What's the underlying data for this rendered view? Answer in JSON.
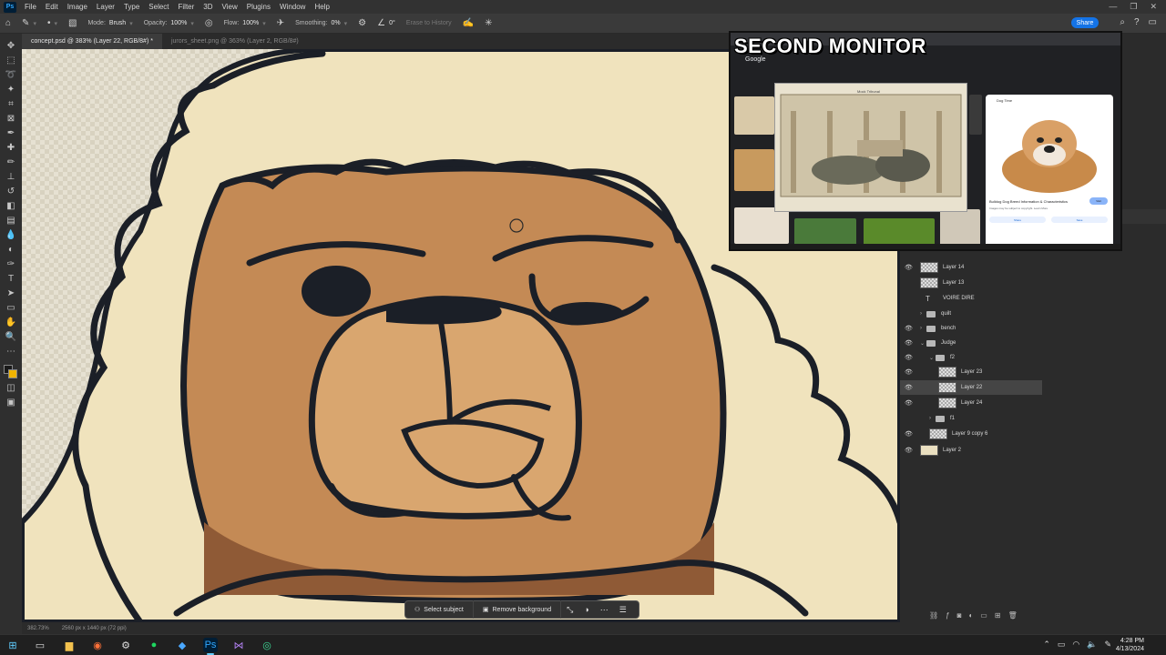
{
  "menu": {
    "items": [
      "File",
      "Edit",
      "Image",
      "Layer",
      "Type",
      "Select",
      "Filter",
      "3D",
      "View",
      "Plugins",
      "Window",
      "Help"
    ]
  },
  "options": {
    "mode_label": "Mode:",
    "mode_value": "Brush",
    "opacity_label": "Opacity:",
    "opacity_value": "100%",
    "flow_label": "Flow:",
    "flow_value": "100%",
    "smoothing_label": "Smoothing:",
    "smoothing_value": "0%",
    "angle_value": "0°",
    "erase_history_label": "Erase to History",
    "share_label": "Share"
  },
  "tabs": [
    {
      "label": "concept.psd @ 383% (Layer 22, RGB/8#) *",
      "active": true
    },
    {
      "label": "jurors_sheet.png @ 363% (Layer 2, RGB/8#)",
      "active": false
    }
  ],
  "status": {
    "zoom": "382.73%",
    "doc_size": "2560 px x 1440 px (72 ppi)"
  },
  "contextbar": {
    "select_subject": "Select subject",
    "remove_background": "Remove background"
  },
  "layers": [
    {
      "name": "Layer 14",
      "kind": "pixel",
      "visible": true,
      "indent": 0
    },
    {
      "name": "Layer 13",
      "kind": "pixel",
      "visible": false,
      "indent": 0
    },
    {
      "name": "VOIRE DIRE",
      "kind": "type",
      "visible": false,
      "indent": 0
    },
    {
      "name": "quilt",
      "kind": "group",
      "visible": false,
      "indent": 0
    },
    {
      "name": "bench",
      "kind": "group",
      "visible": true,
      "indent": 0
    },
    {
      "name": "Judge",
      "kind": "group-open",
      "visible": true,
      "indent": 0
    },
    {
      "name": "f2",
      "kind": "group-open",
      "visible": true,
      "indent": 1
    },
    {
      "name": "Layer 23",
      "kind": "pixel",
      "visible": true,
      "indent": 2
    },
    {
      "name": "Layer 22",
      "kind": "pixel",
      "visible": true,
      "indent": 2,
      "selected": true
    },
    {
      "name": "Layer 24",
      "kind": "pixel",
      "visible": true,
      "indent": 2
    },
    {
      "name": "f1",
      "kind": "group",
      "visible": false,
      "indent": 1
    },
    {
      "name": "Layer 9 copy 6",
      "kind": "pixel",
      "visible": true,
      "indent": 0
    },
    {
      "name": "Layer 2",
      "kind": "solid",
      "visible": true,
      "indent": 0
    }
  ],
  "second_monitor": {
    "title": "SECOND MONITOR",
    "google_label": "Google",
    "painting_caption": "Mock Tribunal",
    "card_source": "Dog Time",
    "card_title": "Bulldog Dog Breed Information & Characteristics",
    "card_subtitle": "Images may be subject to copyright. Learn More",
    "card_visit": "Visit",
    "card_share": "Share",
    "card_save": "Save"
  },
  "taskbar": {
    "time": "4:28 PM",
    "date": "4/13/2024"
  },
  "colors": {
    "accent": "#1473e6",
    "outline": "#1b1f27",
    "fur": "#f0e3bd",
    "face": "#c48a55",
    "face_light": "#d9a66f",
    "face_dark": "#8f5a36",
    "swatch_bg": "#f0b400"
  }
}
